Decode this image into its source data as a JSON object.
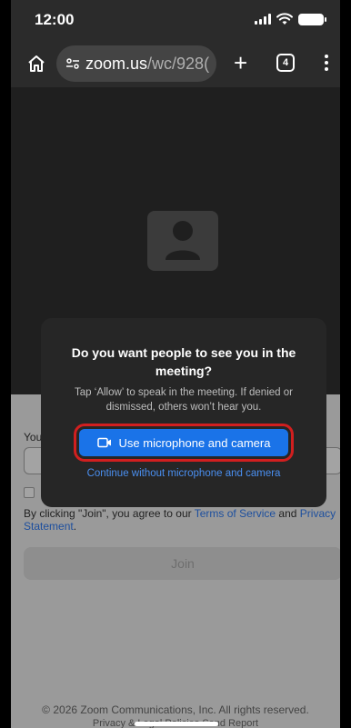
{
  "status_bar": {
    "time": "12:00"
  },
  "browser": {
    "url_host": "zoom.us",
    "url_path": "/wc/928(",
    "tab_count": "4"
  },
  "dialog": {
    "title": "Do you want people to see you in the meeting?",
    "description": "Tap ‘Allow’ to speak in the meeting. If denied or dismissed, others won’t hear you.",
    "allow_label": "Use microphone and camera",
    "deny_label": "Continue without microphone and camera"
  },
  "form": {
    "name_label": "You",
    "terms_prefix": "By clicking \"Join\", you agree to our ",
    "terms_of_service": "Terms of Service",
    "terms_and": " and ",
    "privacy_statement": "Privacy Statement",
    "terms_suffix": ".",
    "join_label": "Join"
  },
  "footer": {
    "copyright": "© 2026 Zoom Communications, Inc. All rights reserved.",
    "links": "Privacy & Legal Policies   Send Report"
  },
  "colors": {
    "primary": "#1a73e8",
    "highlight": "#d11f1f"
  }
}
